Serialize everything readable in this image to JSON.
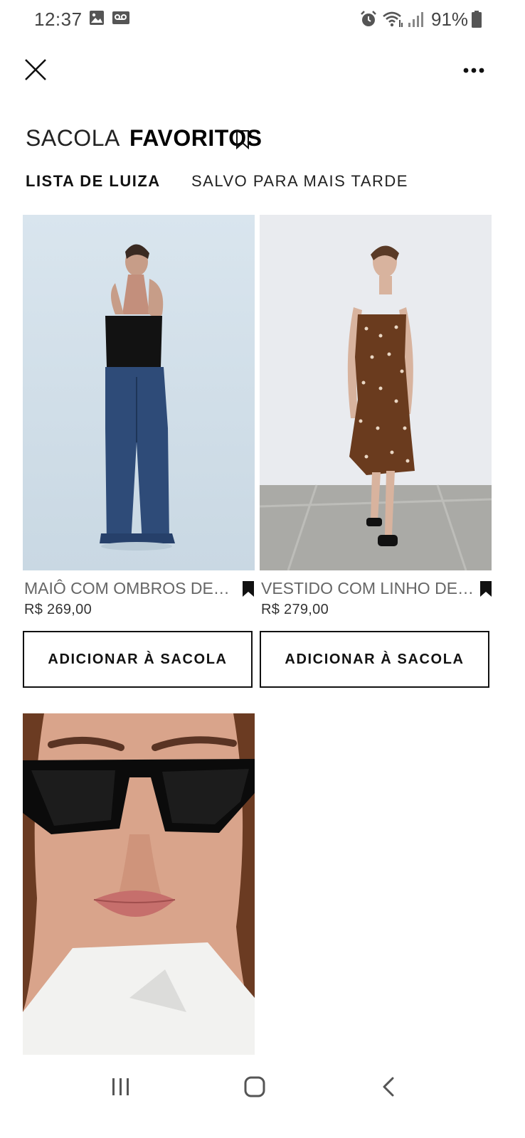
{
  "status_bar": {
    "time": "12:37",
    "battery": "91%",
    "icons": [
      "image-icon",
      "voicemail-icon",
      "alarm-icon",
      "wifi-icon",
      "signal-icon",
      "battery-icon"
    ]
  },
  "top_bar": {
    "icons": [
      "close-icon",
      "more-dots-icon"
    ]
  },
  "tabs": {
    "sacola": "SACOLA",
    "favoritos": "FAVORITOS",
    "active": "favoritos"
  },
  "sub_tabs": {
    "lista": "LISTA DE LUIZA",
    "salvo": "SALVO PARA MAIS TARDE",
    "active": "lista"
  },
  "products": [
    {
      "name": "MAIÔ COM OMBROS DES...",
      "price": "R$ 269,00",
      "button": "ADICIONAR À SACOLA"
    },
    {
      "name": "VESTIDO COM LINHO DE ...",
      "price": "R$ 279,00",
      "button": "ADICIONAR À SACOLA"
    },
    {
      "name": "",
      "price": "",
      "button": ""
    }
  ],
  "nav_bar": {
    "icons": [
      "recent-apps-icon",
      "home-icon",
      "back-icon"
    ]
  },
  "colors": {
    "accent": "#111111",
    "text_muted": "#666666",
    "photo1_bg": "#d7e3ec",
    "photo2_bg": "#e6e8ec"
  }
}
